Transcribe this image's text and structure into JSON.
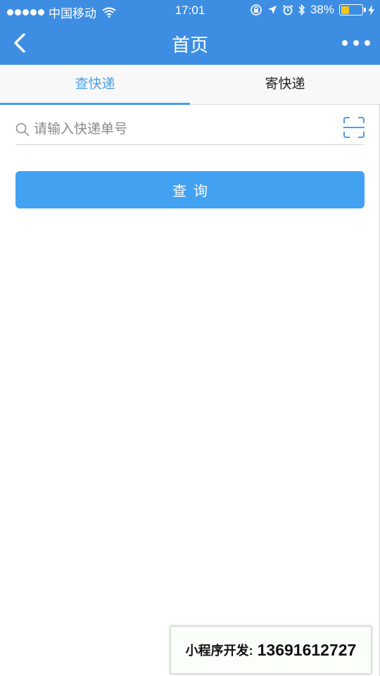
{
  "status_bar": {
    "carrier": "中国移动",
    "time": "17:01",
    "battery_percent": "38%",
    "battery_level": 0.38,
    "icons": [
      "signal-dots-icon",
      "wifi-icon",
      "orientation-lock-icon",
      "location-icon",
      "alarm-icon",
      "bluetooth-icon",
      "battery-icon",
      "charging-icon"
    ]
  },
  "navbar": {
    "title": "首页",
    "back_icon": "chevron-left-icon",
    "more_icon": "more-dots-icon"
  },
  "tabs": [
    {
      "label": "查快递",
      "active": true
    },
    {
      "label": "寄快递",
      "active": false
    }
  ],
  "search": {
    "placeholder": "请输入快递单号",
    "value": "",
    "icon": "search-icon",
    "scan_icon": "scan-icon"
  },
  "query_button": {
    "label": "查询"
  },
  "promo": {
    "label": "小程序开发:",
    "phone": "13691612727"
  },
  "colors": {
    "header": "#3d8ee3",
    "accent": "#4a9fe8",
    "button": "#43a1f2",
    "battery_fill": "#f5c518"
  }
}
